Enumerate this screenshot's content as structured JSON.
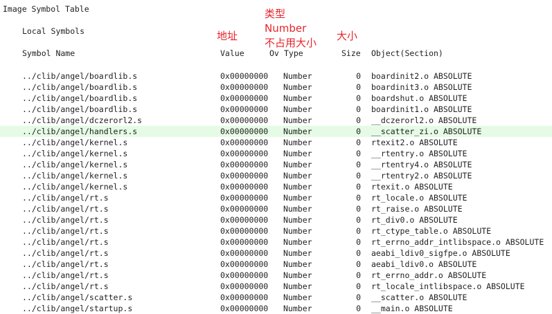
{
  "title": "Image Symbol Table",
  "section": "Local Symbols",
  "headers": {
    "symbol_name": "Symbol Name",
    "value": "Value",
    "ov": "Ov",
    "type": "Type",
    "size": "Size",
    "object": "Object(Section)"
  },
  "annotations": {
    "type_line1": "类型",
    "type_line2": "Number",
    "type_line3": "不占用大小",
    "address": "地址",
    "size": "大小"
  },
  "colors": {
    "annotation": "#e8242c",
    "highlight": "#e6fbe6"
  },
  "highlighted_row": 5,
  "rows": [
    {
      "file": "../clib/angel/boardlib.s",
      "value": "0x00000000",
      "type": "Number",
      "size": "0",
      "object": "boardinit2.o ABSOLUTE"
    },
    {
      "file": "../clib/angel/boardlib.s",
      "value": "0x00000000",
      "type": "Number",
      "size": "0",
      "object": "boardinit3.o ABSOLUTE"
    },
    {
      "file": "../clib/angel/boardlib.s",
      "value": "0x00000000",
      "type": "Number",
      "size": "0",
      "object": "boardshut.o ABSOLUTE"
    },
    {
      "file": "../clib/angel/boardlib.s",
      "value": "0x00000000",
      "type": "Number",
      "size": "0",
      "object": "boardinit1.o ABSOLUTE"
    },
    {
      "file": "../clib/angel/dczerorl2.s",
      "value": "0x00000000",
      "type": "Number",
      "size": "0",
      "object": "__dczerorl2.o ABSOLUTE"
    },
    {
      "file": "../clib/angel/handlers.s",
      "value": "0x00000000",
      "type": "Number",
      "size": "0",
      "object": "__scatter_zi.o ABSOLUTE"
    },
    {
      "file": "../clib/angel/kernel.s",
      "value": "0x00000000",
      "type": "Number",
      "size": "0",
      "object": "rtexit2.o ABSOLUTE"
    },
    {
      "file": "../clib/angel/kernel.s",
      "value": "0x00000000",
      "type": "Number",
      "size": "0",
      "object": "__rtentry.o ABSOLUTE"
    },
    {
      "file": "../clib/angel/kernel.s",
      "value": "0x00000000",
      "type": "Number",
      "size": "0",
      "object": "__rtentry4.o ABSOLUTE"
    },
    {
      "file": "../clib/angel/kernel.s",
      "value": "0x00000000",
      "type": "Number",
      "size": "0",
      "object": "__rtentry2.o ABSOLUTE"
    },
    {
      "file": "../clib/angel/kernel.s",
      "value": "0x00000000",
      "type": "Number",
      "size": "0",
      "object": "rtexit.o ABSOLUTE"
    },
    {
      "file": "../clib/angel/rt.s",
      "value": "0x00000000",
      "type": "Number",
      "size": "0",
      "object": "rt_locale.o ABSOLUTE"
    },
    {
      "file": "../clib/angel/rt.s",
      "value": "0x00000000",
      "type": "Number",
      "size": "0",
      "object": "rt_raise.o ABSOLUTE"
    },
    {
      "file": "../clib/angel/rt.s",
      "value": "0x00000000",
      "type": "Number",
      "size": "0",
      "object": "rt_div0.o ABSOLUTE"
    },
    {
      "file": "../clib/angel/rt.s",
      "value": "0x00000000",
      "type": "Number",
      "size": "0",
      "object": "rt_ctype_table.o ABSOLUTE"
    },
    {
      "file": "../clib/angel/rt.s",
      "value": "0x00000000",
      "type": "Number",
      "size": "0",
      "object": "rt_errno_addr_intlibspace.o ABSOLUTE"
    },
    {
      "file": "../clib/angel/rt.s",
      "value": "0x00000000",
      "type": "Number",
      "size": "0",
      "object": "aeabi_ldiv0_sigfpe.o ABSOLUTE"
    },
    {
      "file": "../clib/angel/rt.s",
      "value": "0x00000000",
      "type": "Number",
      "size": "0",
      "object": "aeabi_ldiv0.o ABSOLUTE"
    },
    {
      "file": "../clib/angel/rt.s",
      "value": "0x00000000",
      "type": "Number",
      "size": "0",
      "object": "rt_errno_addr.o ABSOLUTE"
    },
    {
      "file": "../clib/angel/rt.s",
      "value": "0x00000000",
      "type": "Number",
      "size": "0",
      "object": "rt_locale_intlibspace.o ABSOLUTE"
    },
    {
      "file": "../clib/angel/scatter.s",
      "value": "0x00000000",
      "type": "Number",
      "size": "0",
      "object": "__scatter.o ABSOLUTE"
    },
    {
      "file": "../clib/angel/startup.s",
      "value": "0x00000000",
      "type": "Number",
      "size": "0",
      "object": "__main.o ABSOLUTE"
    }
  ]
}
